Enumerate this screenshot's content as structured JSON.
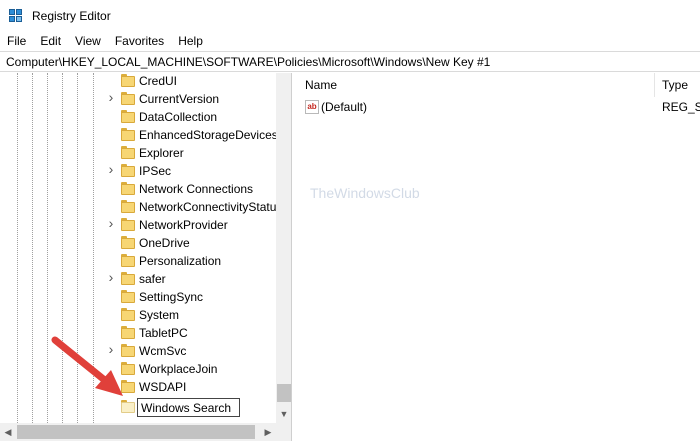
{
  "window": {
    "title": "Registry Editor",
    "icon": "registry-editor-icon"
  },
  "menu": {
    "items": [
      {
        "label": "File"
      },
      {
        "label": "Edit"
      },
      {
        "label": "View"
      },
      {
        "label": "Favorites"
      },
      {
        "label": "Help"
      }
    ]
  },
  "address": {
    "value": "Computer\\HKEY_LOCAL_MACHINE\\SOFTWARE\\Policies\\Microsoft\\Windows\\New Key #1"
  },
  "tree": {
    "items": [
      {
        "label": "CredUI",
        "expandable": false
      },
      {
        "label": "CurrentVersion",
        "expandable": true
      },
      {
        "label": "DataCollection",
        "expandable": false
      },
      {
        "label": "EnhancedStorageDevices",
        "expandable": false
      },
      {
        "label": "Explorer",
        "expandable": false
      },
      {
        "label": "IPSec",
        "expandable": true
      },
      {
        "label": "Network Connections",
        "expandable": false
      },
      {
        "label": "NetworkConnectivityStatu",
        "expandable": false
      },
      {
        "label": "NetworkProvider",
        "expandable": true
      },
      {
        "label": "OneDrive",
        "expandable": false
      },
      {
        "label": "Personalization",
        "expandable": false
      },
      {
        "label": "safer",
        "expandable": true
      },
      {
        "label": "SettingSync",
        "expandable": false
      },
      {
        "label": "System",
        "expandable": false
      },
      {
        "label": "TabletPC",
        "expandable": false
      },
      {
        "label": "WcmSvc",
        "expandable": true
      },
      {
        "label": "WorkplaceJoin",
        "expandable": false
      },
      {
        "label": "WSDAPI",
        "expandable": false
      }
    ],
    "rename_value": "Windows Search"
  },
  "values_pane": {
    "columns": [
      {
        "label": "Name"
      },
      {
        "label": "Type"
      }
    ],
    "rows": [
      {
        "name": "(Default)",
        "type": "REG_SZ",
        "icon": "string-value-icon"
      }
    ]
  },
  "watermark": {
    "text": "TheWindowsClub"
  },
  "colors": {
    "folder": "#f7d674",
    "arrow": "#e0403a",
    "accent": "#2f8fd8"
  }
}
